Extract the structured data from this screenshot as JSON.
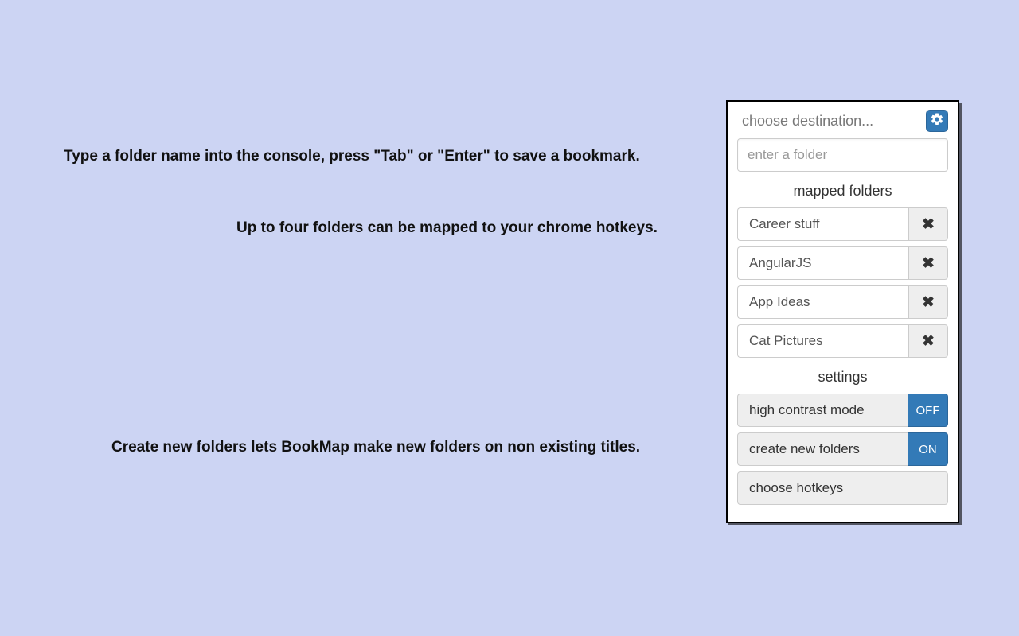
{
  "instructions": {
    "line1": "Type a folder name into the console, press \"Tab\" or \"Enter\" to save a bookmark.",
    "line2": "Up to four folders can be mapped to your chrome hotkeys.",
    "line3": "Create new folders lets BookMap make new folders on non existing titles."
  },
  "panel": {
    "choose_label": "choose destination...",
    "input_placeholder": "enter a folder",
    "mapped_heading": "mapped folders",
    "mapped": [
      {
        "name": "Career stuff"
      },
      {
        "name": "AngularJS"
      },
      {
        "name": "App Ideas"
      },
      {
        "name": "Cat Pictures"
      }
    ],
    "settings_heading": "settings",
    "settings": {
      "high_contrast_label": "high contrast mode",
      "high_contrast_value": "OFF",
      "create_folders_label": "create new folders",
      "create_folders_value": "ON",
      "choose_hotkeys_label": "choose hotkeys"
    }
  }
}
